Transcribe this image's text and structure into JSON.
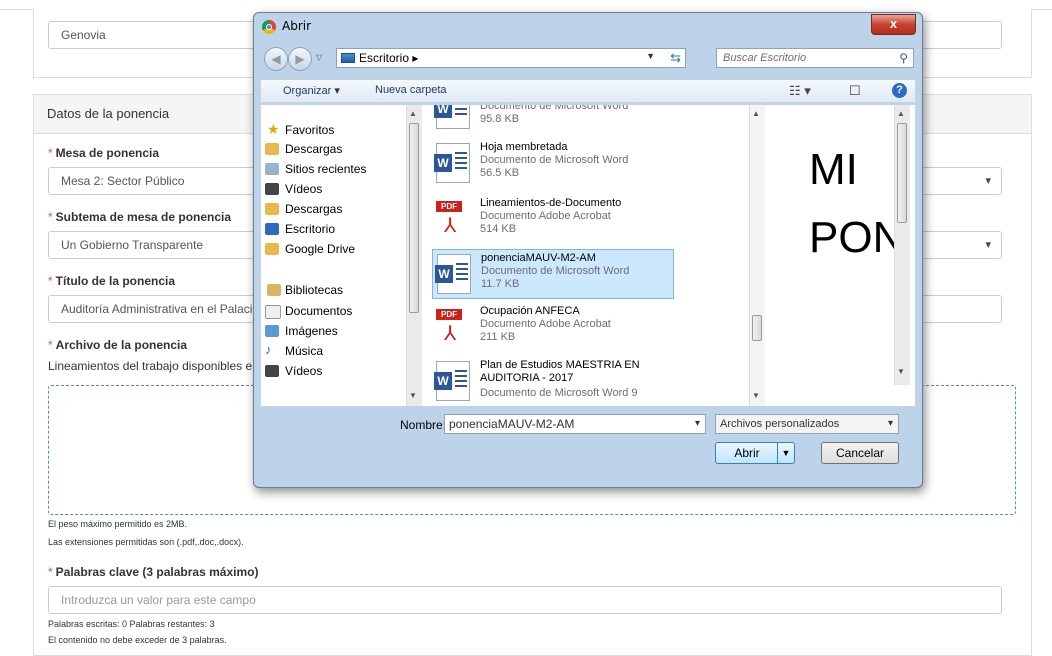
{
  "form": {
    "country_value": "Genovia",
    "section_title": "Datos de la ponencia",
    "required_mark": "*",
    "mesa_label": "Mesa de ponencia",
    "mesa_value": "Mesa 2: Sector Público",
    "subtema_label": "Subtema de mesa de ponencia",
    "subtema_value": "Un Gobierno Transparente",
    "titulo_label": "Título de la ponencia",
    "titulo_value": "Auditoría Administrativa en el Palacio",
    "archivo_label": "Archivo de la ponencia",
    "archivo_help": "Lineamientos del trabajo disponibles e",
    "peso_note": "El peso máximo permitido es 2MB.",
    "ext_note": "Las extensiones permitidas son (.pdf,.doc,.docx).",
    "palabras_label": "Palabras clave (3 palabras máximo)",
    "palabras_placeholder": "Introduzca un valor para este campo",
    "palabras_count": "Palabras escritas: 0 Palabras restantes: 3",
    "palabras_limit": "El contenido no debe exceder de 3 palabras."
  },
  "dialog": {
    "title": "Abrir",
    "close_label": "x",
    "address": "Escritorio",
    "address_sep": "▸",
    "search_placeholder": "Buscar Escritorio",
    "organize": "Organizar ▾",
    "new_folder": "Nueva carpeta",
    "nav": {
      "favorites": "Favoritos",
      "items_fav": [
        "Descargas",
        "Sitios recientes",
        "Vídeos",
        "Descargas",
        "Escritorio",
        "Google Drive"
      ],
      "libraries": "Bibliotecas",
      "items_lib": [
        "Documentos",
        "Imágenes",
        "Música",
        "Vídeos"
      ]
    },
    "files": [
      {
        "name": "",
        "type": "Documento de Microsoft Word",
        "size": "95.8 KB",
        "icon": "word"
      },
      {
        "name": "Hoja membretada",
        "type": "Documento de Microsoft Word",
        "size": "56.5 KB",
        "icon": "word"
      },
      {
        "name": "Lineamientos-de-Documento",
        "type": "Documento Adobe Acrobat",
        "size": "514 KB",
        "icon": "pdf"
      },
      {
        "name": "ponenciaMAUV-M2-AM",
        "type": "Documento de Microsoft Word",
        "size": "11.7 KB",
        "icon": "word"
      },
      {
        "name": "Ocupación ANFECA",
        "type": "Documento Adobe Acrobat",
        "size": "211 KB",
        "icon": "pdf"
      },
      {
        "name": "Plan de Estudios MAESTRIA EN AUDITORIA - 2017",
        "type": "Documento de Microsoft Word 9",
        "size": "",
        "icon": "word"
      }
    ],
    "preview_line1": "MI",
    "preview_line2": "PON",
    "name_label": "Nombre:",
    "name_value": "ponenciaMAUV-M2-AM",
    "filter_value": "Archivos personalizados",
    "open_label": "Abrir",
    "cancel_label": "Cancelar"
  },
  "colors": {
    "required": "#d9534f",
    "dropzone": "#4a90d9",
    "selection": "#cce8ff"
  }
}
